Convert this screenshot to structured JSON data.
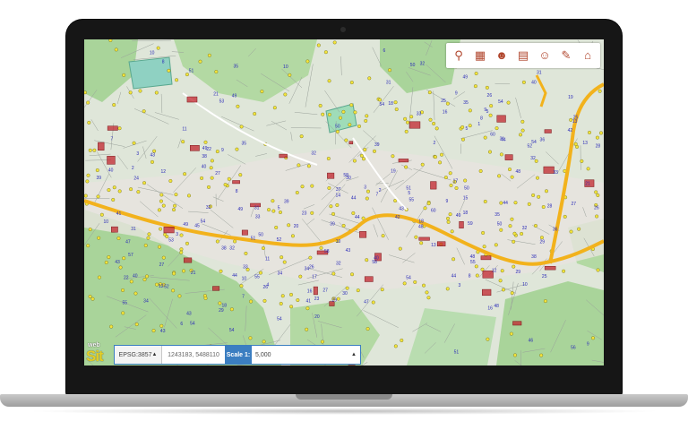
{
  "app": {
    "logo_small": "web",
    "logo_big": "Sit"
  },
  "toolbar": {
    "tools": [
      {
        "icon": "magnet-icon",
        "glyph": "⚲"
      },
      {
        "icon": "layers-map-icon",
        "glyph": "▦"
      },
      {
        "icon": "user-search-icon",
        "glyph": "☻"
      },
      {
        "icon": "grid-map-icon",
        "glyph": "▤"
      },
      {
        "icon": "user-edit-icon",
        "glyph": "☺"
      },
      {
        "icon": "measure-icon",
        "glyph": "✎"
      },
      {
        "icon": "house-icon",
        "glyph": "⌂"
      }
    ]
  },
  "status": {
    "epsg": "EPSG:3857",
    "coords": "1243183, 5488110",
    "scale_label": "Scale 1:",
    "scale_value": "5,000"
  },
  "colors": {
    "map_background": "#dfe6d9",
    "forest": "#a9d49a",
    "road_major": "#f2b21c",
    "building_points": "#f3e43b",
    "labels": "#2a2ab8",
    "selected_buildings": "#c2262e",
    "accent": "#3b7ec1"
  }
}
